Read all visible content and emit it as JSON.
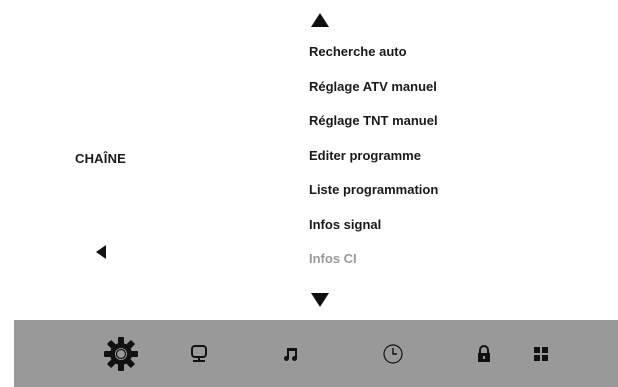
{
  "section": {
    "label": "CHAÎNE"
  },
  "navigation": {
    "scroll_up_icon": "triangle-up",
    "scroll_down_icon": "triangle-down",
    "back_icon": "triangle-left"
  },
  "menu": {
    "items": [
      {
        "label": "Recherche auto",
        "enabled": true
      },
      {
        "label": "Réglage ATV manuel",
        "enabled": true
      },
      {
        "label": "Réglage TNT manuel",
        "enabled": true
      },
      {
        "label": "Editer programme",
        "enabled": true
      },
      {
        "label": "Liste programmation",
        "enabled": true
      },
      {
        "label": "Infos signal",
        "enabled": true
      },
      {
        "label": "Infos CI",
        "enabled": false
      }
    ]
  },
  "bottom_bar": {
    "background": "#999999",
    "tabs": [
      {
        "icon": "gear-icon",
        "selected": true
      },
      {
        "icon": "monitor-icon",
        "selected": false
      },
      {
        "icon": "music-note-icon",
        "selected": false
      },
      {
        "icon": "clock-icon",
        "selected": false
      },
      {
        "icon": "lock-icon",
        "selected": false
      },
      {
        "icon": "grid-icon",
        "selected": false
      }
    ]
  },
  "colors": {
    "text": "#1a1a1a",
    "disabled_text": "#9a9a9a",
    "icon": "#111111"
  }
}
